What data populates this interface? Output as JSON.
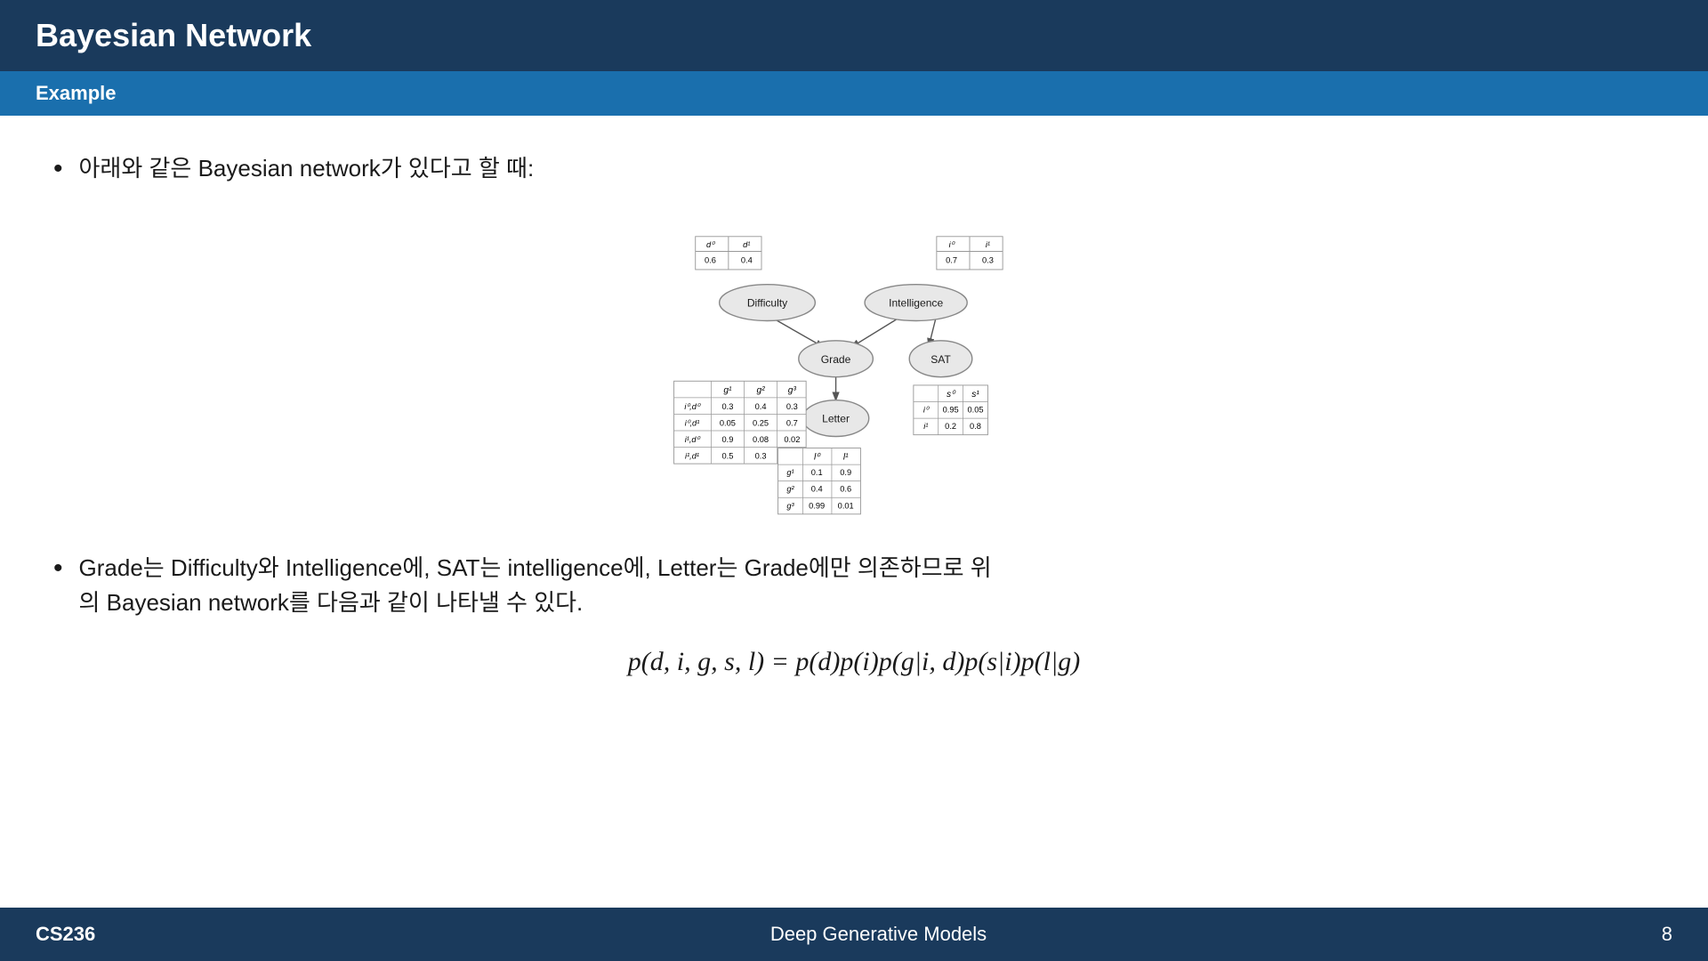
{
  "header": {
    "title": "Bayesian Network"
  },
  "section": {
    "title": "Example"
  },
  "bullets": [
    {
      "text": "아래와 같은 Bayesian network가 있다고 할 때:"
    },
    {
      "text": "Grade는 Difficulty와 Intelligence에, SAT는 intelligence에, Letter는 Grade에만 의존하므로 위의 Bayesian network를 다음과 같이 나타낼 수 있다."
    }
  ],
  "formula": "p(d, i, g, s, l) = p(d)p(i)p(g|i, d)p(s|i)p(l|g)",
  "footer": {
    "left": "CS236",
    "center": "Deep Generative Models",
    "right": "8"
  },
  "nodes": {
    "difficulty": "Difficulty",
    "intelligence": "Intelligence",
    "grade": "Grade",
    "sat": "SAT",
    "letter": "Letter"
  }
}
